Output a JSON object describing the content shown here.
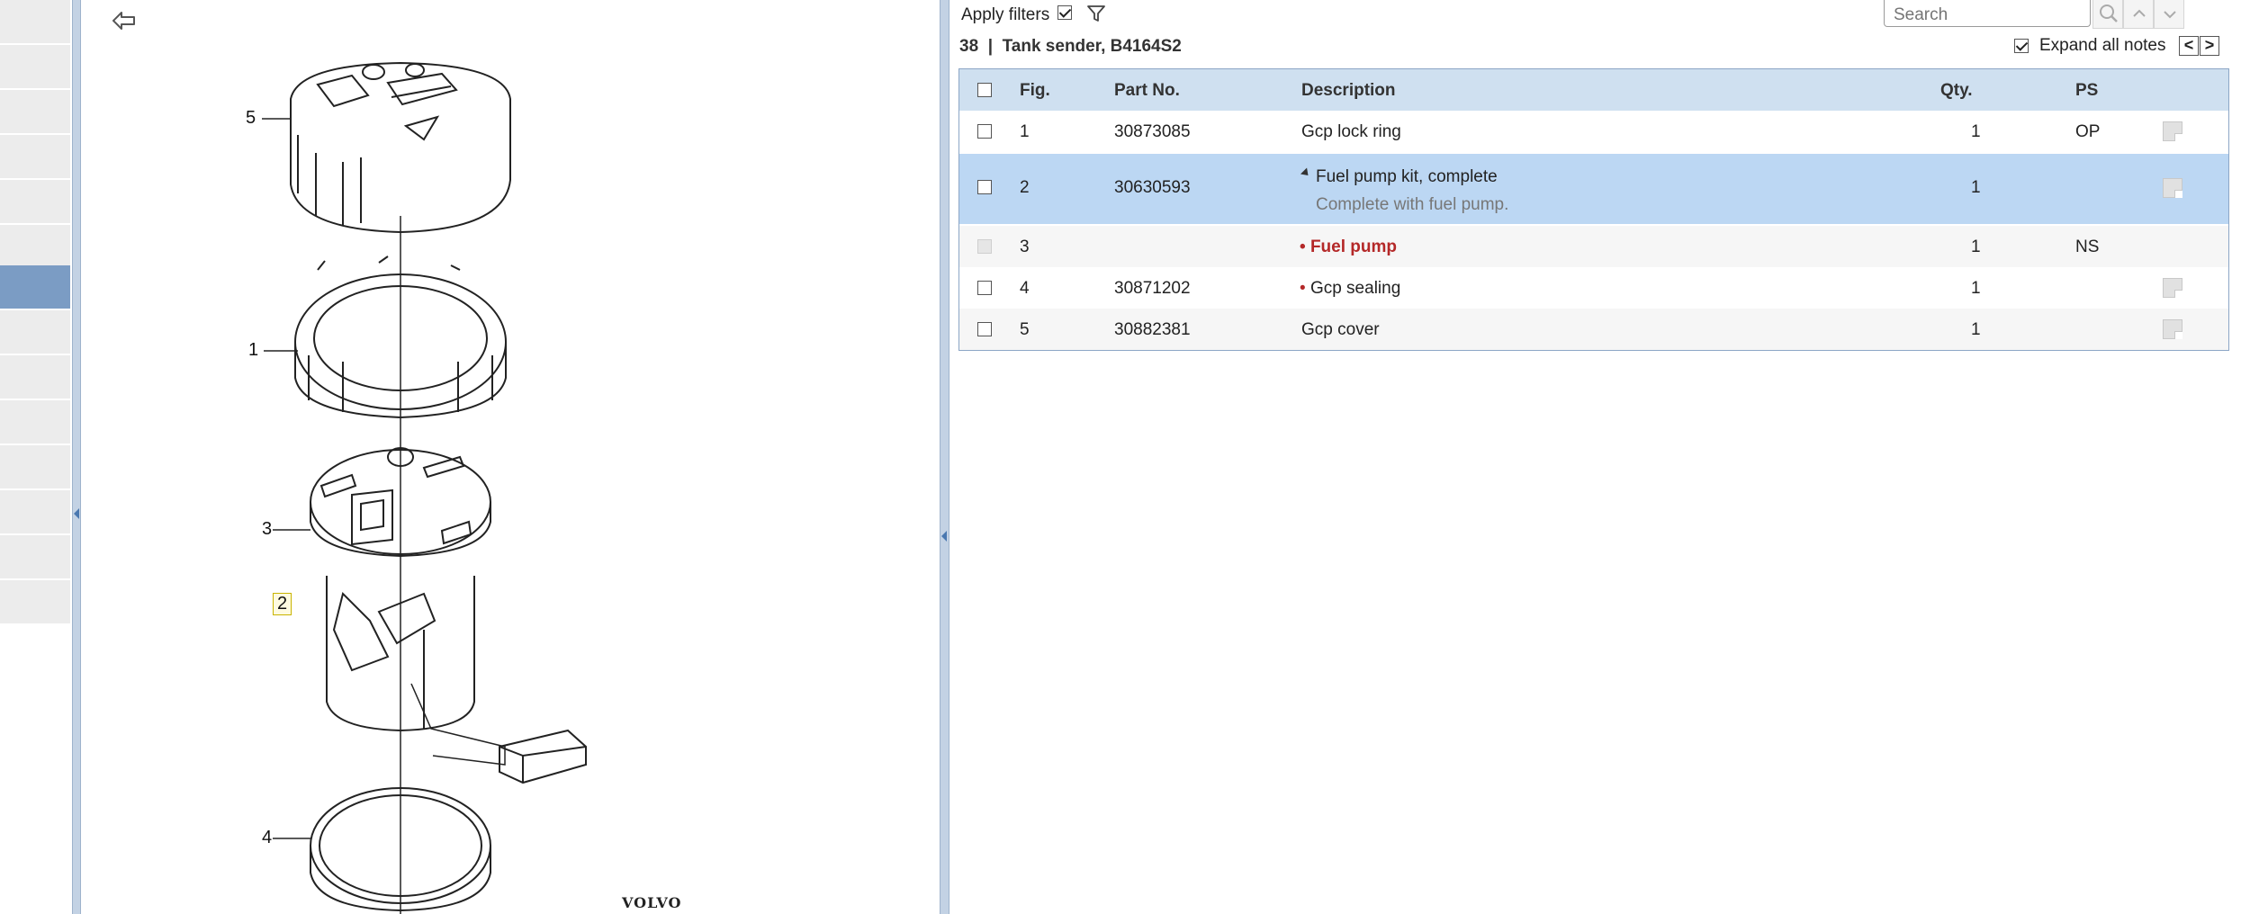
{
  "illustration": {
    "callouts": [
      "5",
      "1",
      "3",
      "2",
      "4"
    ],
    "highlighted_callout": "2",
    "brand_mark": "VOLVO",
    "back_icon": "back-arrow-icon"
  },
  "toolbar": {
    "apply_filters_label": "Apply filters",
    "apply_filters_checked": true,
    "filter_icon": "funnel-icon",
    "search_placeholder": "Search",
    "search_icon": "magnifier-icon",
    "prev_icon": "chevron-up-icon",
    "next_icon": "chevron-down-icon"
  },
  "group": {
    "number": "38",
    "separator": "|",
    "title": "Tank sender, B4164S2"
  },
  "expand_notes": {
    "label": "Expand all notes",
    "checked": true,
    "prev": "<",
    "next": ">"
  },
  "table": {
    "headers": {
      "fig": "Fig.",
      "part_no": "Part No.",
      "description": "Description",
      "qty": "Qty.",
      "ps": "PS"
    },
    "rows": [
      {
        "fig": "1",
        "part_no": "30873085",
        "description": "Gcp lock ring",
        "qty": "1",
        "ps": "OP",
        "has_note": true
      },
      {
        "fig": "2",
        "part_no": "30630593",
        "description": "Fuel pump kit, complete",
        "note": "Complete with fuel pump.",
        "qty": "1",
        "ps": "",
        "has_note": true,
        "selected": true,
        "expanded": true
      },
      {
        "fig": "3",
        "part_no": "",
        "description": "Fuel pump",
        "qty": "1",
        "ps": "NS",
        "has_note": false,
        "bullet": true,
        "red": true,
        "disabled": true
      },
      {
        "fig": "4",
        "part_no": "30871202",
        "description": "Gcp sealing",
        "qty": "1",
        "ps": "",
        "has_note": true,
        "bullet": true
      },
      {
        "fig": "5",
        "part_no": "30882381",
        "description": "Gcp cover",
        "qty": "1",
        "ps": "",
        "has_note": true
      }
    ]
  },
  "colors": {
    "header_bg": "#cfe0f0",
    "selected_row": "#bcd7f3",
    "accent_red": "#b42828",
    "nav_active": "#7b9cc4"
  }
}
